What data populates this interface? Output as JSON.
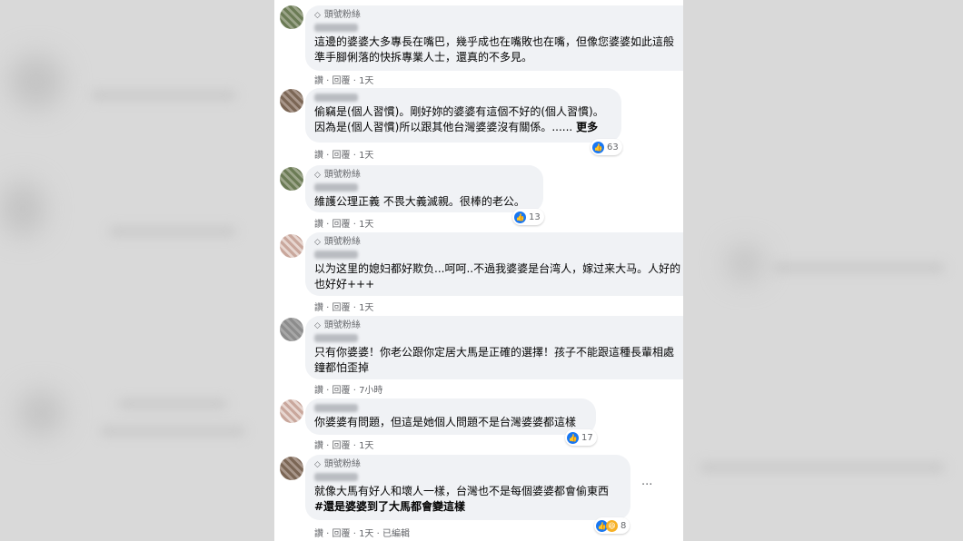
{
  "badge_label": "頭號粉絲",
  "comments": [
    {
      "text_lines": [
        "這邊的婆婆大多專長在嘴巴，幾乎成也在嘴敗也在嘴，但像您婆婆如此這般",
        "準手腳俐落的快拆專業人士，還真的不多見。"
      ],
      "actions": "讚 · 回覆 · 1天"
    },
    {
      "text_lines": [
        "偷竊是(個人習慣)。剛好妳的婆婆有這個不好的(個人習慣)。",
        "因為是(個人習慣)所以跟其他台灣婆婆沒有關係。......"
      ],
      "more": "更多",
      "actions": "讚 · 回覆 · 1天",
      "reaction_count": "63"
    },
    {
      "text_lines": [
        "維護公理正義 不畏大義滅親。很棒的老公。"
      ],
      "actions": "讚 · 回覆 · 1天",
      "reaction_count": "13"
    },
    {
      "text_lines": [
        "以为这里的媳妇都好欺负...呵呵..不過我婆婆是台湾人，嫁过来大马。人好的",
        "也好好+++"
      ],
      "actions": "讚 · 回覆 · 1天"
    },
    {
      "text_lines": [
        "只有你婆婆！你老公跟你定居大馬是正確的選擇！孩子不能跟這種長輩相處",
        "鐘都怕歪掉"
      ],
      "actions": "讚 · 回覆 · 7小時"
    },
    {
      "text_lines": [
        "你婆婆有問題，但這是她個人問題不是台灣婆婆都這樣"
      ],
      "actions": "讚 · 回覆 · 1天",
      "reaction_count": "17"
    },
    {
      "text_lines": [
        "就像大馬有好人和壞人一樣，台灣也不是每個婆婆都會偷東西",
        "#還是婆婆到了大馬都會變這樣"
      ],
      "actions": "讚 · 回覆 · 1天 · 已編輯",
      "reaction_count": "8"
    }
  ],
  "more_options": "···",
  "icons": {
    "badge": "diamond-icon",
    "like": "like-icon",
    "haha": "haha-icon"
  },
  "colors": {
    "like_blue": "#1877f2",
    "bubble_bg": "#f0f2f5",
    "meta_gray": "#65676b"
  }
}
